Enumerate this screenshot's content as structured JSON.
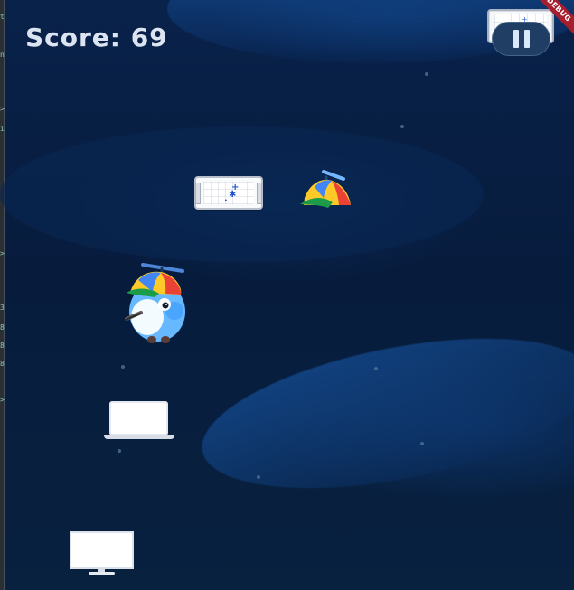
{
  "score": {
    "label": "Score: 69"
  },
  "pause_button": {
    "label": "Pause",
    "icon": "pause-icon"
  },
  "debug_banner": {
    "label": "DEBUG"
  },
  "game_objects": {
    "player": "blue bird with propeller hat",
    "powerup": "propeller hat",
    "platforms": [
      "tablet",
      "tablet",
      "laptop",
      "monitor"
    ]
  },
  "left_edge": {
    "visible_glyphs": [
      "t",
      "n",
      "i",
      "3",
      "8",
      "8",
      "8",
      ">",
      ">",
      ">"
    ]
  },
  "colors": {
    "background": "#08203f",
    "score_text": "#dce4f2",
    "pause_background": "#203d63",
    "debug_red": "#a91e2f",
    "bird_blue": "#63b7ff",
    "hat_yellow": "#ffc928",
    "hat_red": "#ea4335",
    "hat_green": "#1c9c48",
    "hat_blue": "#4285f4"
  }
}
